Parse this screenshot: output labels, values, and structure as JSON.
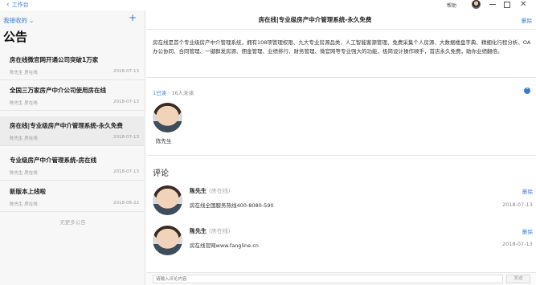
{
  "topbar": {
    "back_label": "工作台",
    "help_label": "帮助"
  },
  "sidebar": {
    "filter_label": "我接收的",
    "page_title": "公告",
    "no_more": "无更多公告",
    "notices": [
      {
        "title": "房在线微官网开通公司突破1万家",
        "author": "陈先生 房在线",
        "date": "2018-07-13"
      },
      {
        "title": "全国三万家房产中介公司使用房在线",
        "author": "陈先生 房在线",
        "date": "2018-07-13"
      },
      {
        "title": "房在线|专业级房产中介管理系统-永久免费",
        "author": "陈先生 房在线",
        "date": "2018-07-13"
      },
      {
        "title": "专业级房产中介管理系统-房在线",
        "author": "陈先生 房在线",
        "date": "2018-07-13"
      },
      {
        "title": "新版本上线啦",
        "author": "陈先生 房在线",
        "date": "2018-06-22"
      }
    ]
  },
  "detail": {
    "title": "房在线|专业级房产中介管理系统-永久免费",
    "delete_label": "删除",
    "body": "房在线是首个专业级房产中介管理系统，拥有108项管理权限、九大专业房源品类、人工智能客源管理、免费采集个人房源、大数据楼盘字典、精细化行程分析、OA 办公协同、合同管理、一键群发房源、佣金管理、业绩排行、财务管理、微官网等专业强大的功能，极简设计操作顺手，首店永久免费，助你业绩翻倍。",
    "read_count": "1已读",
    "separator": "·",
    "unread_count": "16人未读",
    "reader_name": "陈先生",
    "comments_heading": "评论",
    "comments": [
      {
        "name": "陈先生",
        "company": "(房在线)",
        "text": "房在线全国服务热线400-8080-590",
        "date": "2018-07-13",
        "delete": "删除"
      },
      {
        "name": "陈先生",
        "company": "(房在线)",
        "text": "房在线官网www.fangline.cn",
        "date": "2018-07-13",
        "delete": "删除"
      }
    ],
    "input_placeholder": "请输入评论内容",
    "send_label": "发送"
  }
}
